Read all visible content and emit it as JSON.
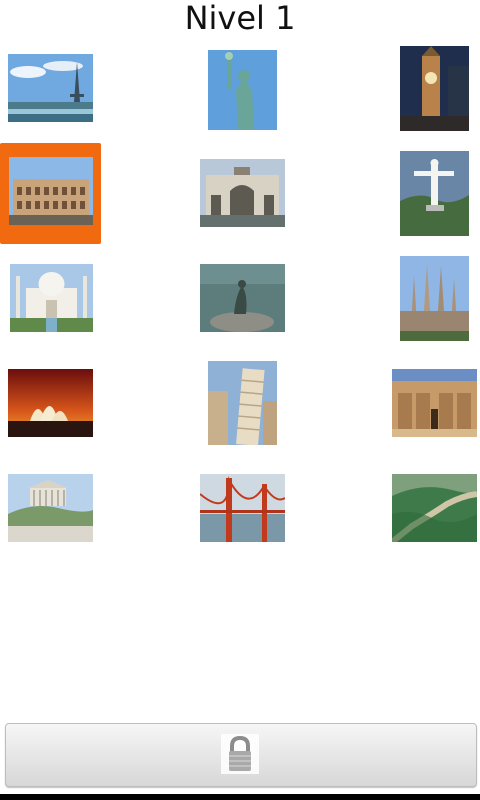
{
  "header": {
    "title": "Nivel 1"
  },
  "grid": {
    "items": [
      {
        "name": "eiffel-tower"
      },
      {
        "name": "statue-of-liberty"
      },
      {
        "name": "big-ben"
      },
      {
        "name": "colosseum",
        "selected": true
      },
      {
        "name": "puerta-de-alcala"
      },
      {
        "name": "christ-the-redeemer"
      },
      {
        "name": "taj-mahal"
      },
      {
        "name": "little-mermaid"
      },
      {
        "name": "sagrada-familia"
      },
      {
        "name": "sydney-opera-house"
      },
      {
        "name": "leaning-tower-of-pisa"
      },
      {
        "name": "abu-simbel"
      },
      {
        "name": "acropolis"
      },
      {
        "name": "golden-gate-bridge"
      },
      {
        "name": "great-wall"
      }
    ]
  },
  "footer": {
    "button_icon": "lock-icon"
  },
  "colors": {
    "selected_frame": "#f26a0f"
  }
}
